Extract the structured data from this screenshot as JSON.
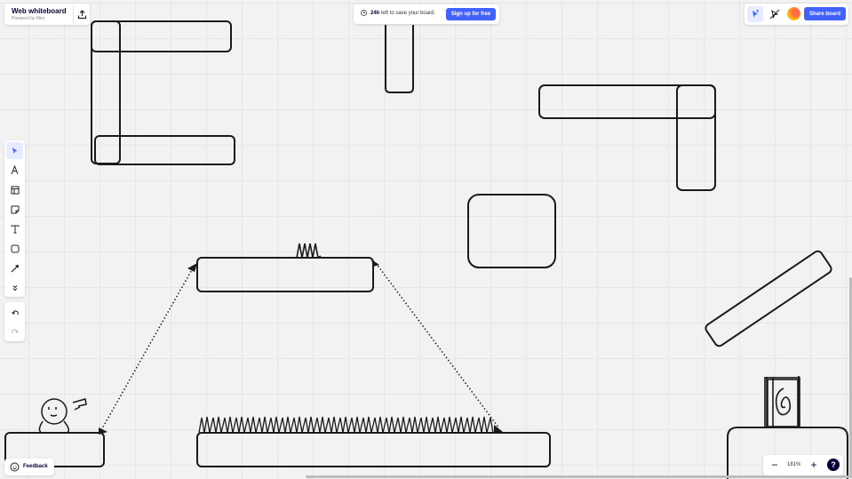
{
  "header": {
    "title": "Web whiteboard",
    "subtitle": "Powered by Miro"
  },
  "save_notice": {
    "time": "24h",
    "text": "left to save your board.",
    "signup_label": "Sign up for free"
  },
  "share": {
    "label": "Share board",
    "brand_color": "#4262ff"
  },
  "toolbar": {
    "tools": [
      "select-icon",
      "pen-icon",
      "templates-icon",
      "sticky-note-icon",
      "text-icon",
      "shape-icon",
      "connector-icon",
      "more-tools-icon"
    ],
    "undo": "undo-icon",
    "redo": "redo-icon"
  },
  "feedback": {
    "label": "Feedback"
  },
  "zoom": {
    "minus": "−",
    "value": "181%",
    "plus": "+",
    "help": "?"
  }
}
